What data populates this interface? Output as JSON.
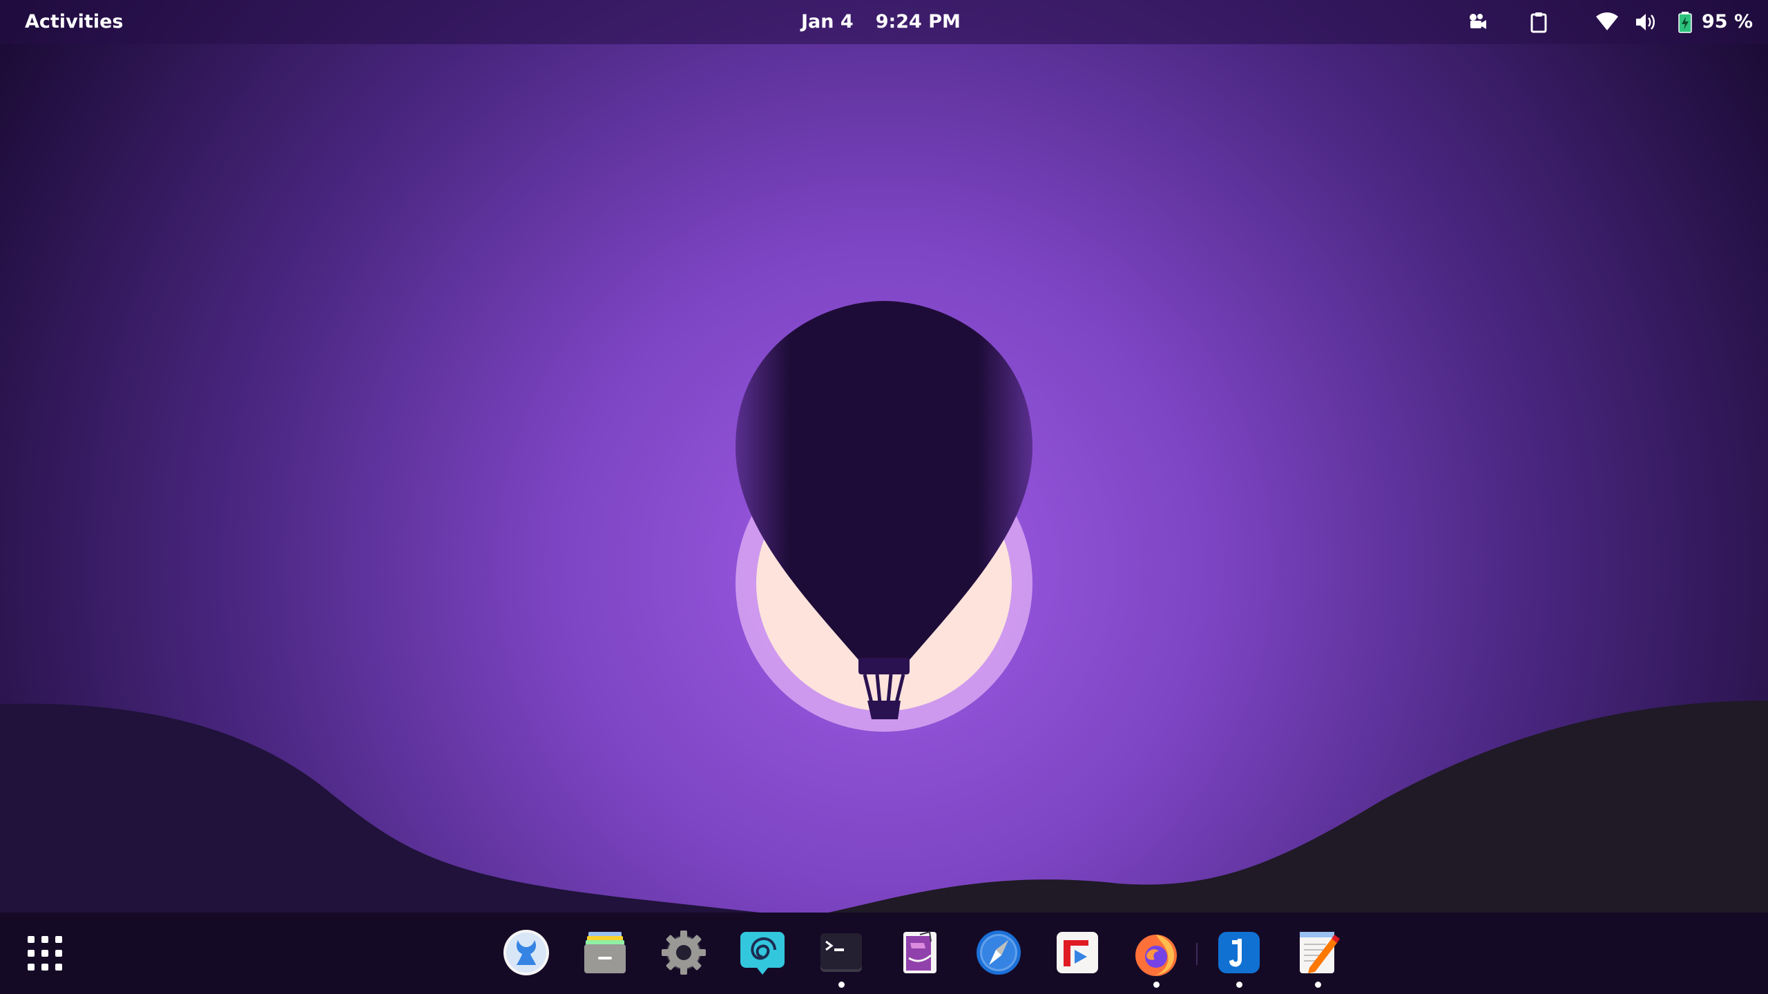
{
  "topbar": {
    "activities_label": "Activities",
    "date": "Jan 4",
    "time": "9:24 PM",
    "battery_percent": "95 %"
  },
  "tray_icons": [
    "screencast-icon",
    "clipboard-icon",
    "wifi-icon",
    "volume-icon",
    "battery-icon"
  ],
  "dock": {
    "show_apps_icon": "grid-icon",
    "apps": [
      {
        "name": "flatseal",
        "running": false
      },
      {
        "name": "files",
        "running": false
      },
      {
        "name": "settings",
        "running": false
      },
      {
        "name": "fractal",
        "running": false
      },
      {
        "name": "terminal",
        "running": true
      },
      {
        "name": "paper-clip",
        "running": false
      },
      {
        "name": "epiphany-web",
        "running": false
      },
      {
        "name": "flathub-store",
        "running": false
      },
      {
        "name": "firefox",
        "running": true
      },
      {
        "name": "joplin",
        "running": true
      },
      {
        "name": "text-editor",
        "running": true
      }
    ]
  },
  "colors": {
    "wallpaper_glow": "#a05ce6",
    "wallpaper_edge": "#1a0a33",
    "sun": "#fde3dc",
    "balloon": "#1e0c38",
    "hills_left": "#20123a",
    "hills_right": "#1f1a26",
    "dock_bg": "#150a26"
  }
}
